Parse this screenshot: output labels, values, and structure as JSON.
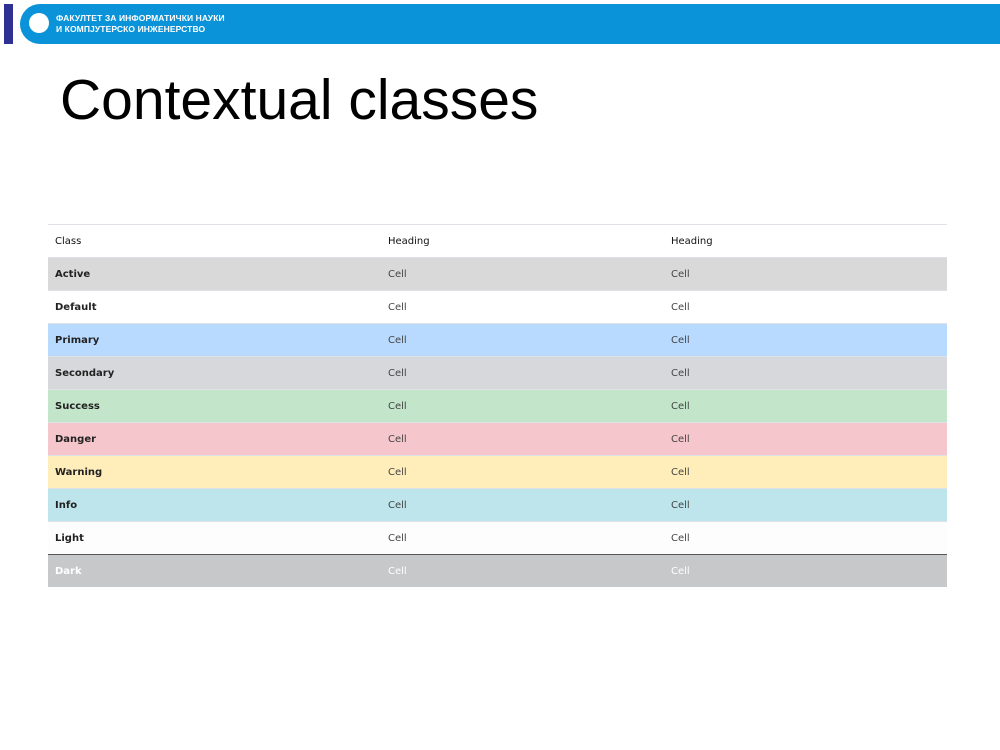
{
  "header": {
    "line1": "ФАКУЛТЕТ ЗА ИНФОРМАТИЧКИ НАУКИ",
    "line2": "И КОМПЈУТЕРСКО ИНЖЕНЕРСТВО",
    "band_color": "#0a93d9",
    "accent_color": "#2e3192"
  },
  "title": "Contextual classes",
  "table": {
    "headers": [
      "Class",
      "Heading",
      "Heading"
    ],
    "rows": [
      {
        "label": "Active",
        "cells": [
          "Cell",
          "Cell"
        ],
        "color": "#d9d9d9"
      },
      {
        "label": "Default",
        "cells": [
          "Cell",
          "Cell"
        ],
        "color": "#ffffff"
      },
      {
        "label": "Primary",
        "cells": [
          "Cell",
          "Cell"
        ],
        "color": "#b8daff"
      },
      {
        "label": "Secondary",
        "cells": [
          "Cell",
          "Cell"
        ],
        "color": "#d6d8db"
      },
      {
        "label": "Success",
        "cells": [
          "Cell",
          "Cell"
        ],
        "color": "#c3e6cb"
      },
      {
        "label": "Danger",
        "cells": [
          "Cell",
          "Cell"
        ],
        "color": "#f5c6cb"
      },
      {
        "label": "Warning",
        "cells": [
          "Cell",
          "Cell"
        ],
        "color": "#ffeeba"
      },
      {
        "label": "Info",
        "cells": [
          "Cell",
          "Cell"
        ],
        "color": "#bee5eb"
      },
      {
        "label": "Light",
        "cells": [
          "Cell",
          "Cell"
        ],
        "color": "#fdfdfe"
      },
      {
        "label": "Dark",
        "cells": [
          "Cell",
          "Cell"
        ],
        "color": "#c6c8ca"
      }
    ]
  }
}
